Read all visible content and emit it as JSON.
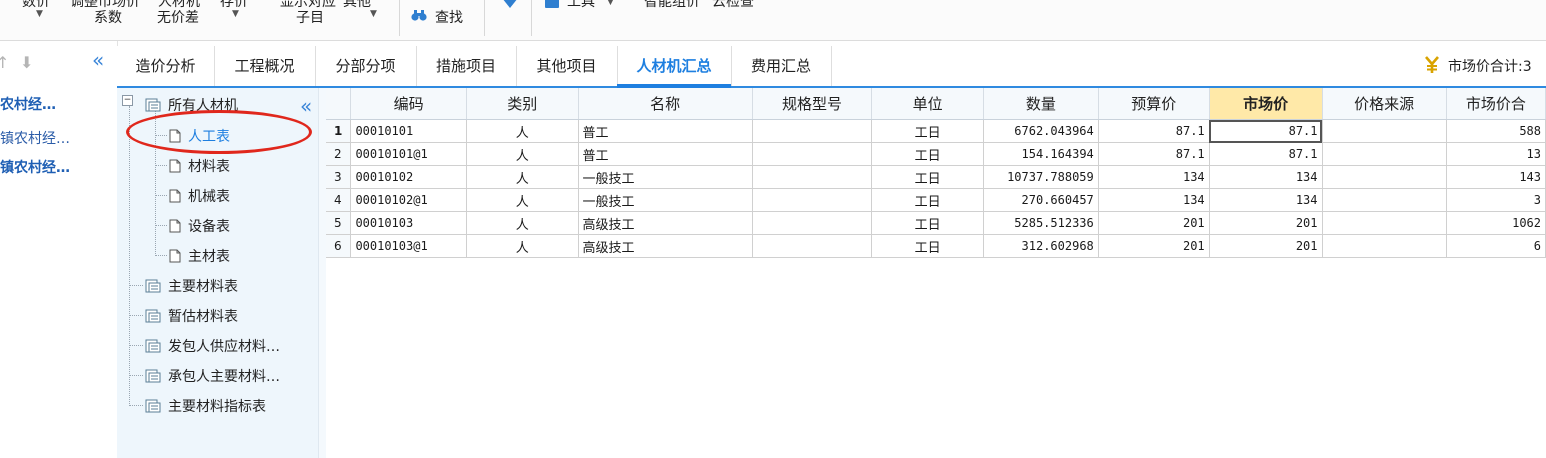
{
  "ribbon": {
    "row1_partial": [
      "数价",
      "调整市场价",
      "人材机",
      "存价",
      "显示对应",
      "其他",
      "智能组价",
      "云检查"
    ],
    "row2": [
      "系数",
      "无价差",
      "子目"
    ],
    "find_label": "查找",
    "tool_label": "工具"
  },
  "left_nav": {
    "projects": [
      "农村经…",
      "镇农村经…",
      "镇农村经…"
    ]
  },
  "tabs": [
    {
      "label": "造价分析"
    },
    {
      "label": "工程概况"
    },
    {
      "label": "分部分项"
    },
    {
      "label": "措施项目"
    },
    {
      "label": "其他项目"
    },
    {
      "label": "人材机汇总",
      "active": true
    },
    {
      "label": "费用汇总"
    }
  ],
  "market_total_label": "市场价合计:3",
  "tree": {
    "root": "所有人材机",
    "children": [
      "人工表",
      "材料表",
      "机械表",
      "设备表",
      "主材表"
    ],
    "reports": [
      "主要材料表",
      "暂估材料表",
      "发包人供应材料…",
      "承包人主要材料…",
      "主要材料指标表"
    ],
    "selected": "人工表"
  },
  "grid": {
    "columns": [
      "编码",
      "类别",
      "名称",
      "规格型号",
      "单位",
      "数量",
      "预算价",
      "市场价",
      "价格来源",
      "市场价合"
    ],
    "rows": [
      {
        "no": "1",
        "code": "00010101",
        "type": "人",
        "name": "普工",
        "spec": "",
        "unit": "工日",
        "qty": "6762.043964",
        "budget": "87.1",
        "market": "87.1",
        "source": "",
        "market_total": "588"
      },
      {
        "no": "2",
        "code": "00010101@1",
        "type": "人",
        "name": "普工",
        "spec": "",
        "unit": "工日",
        "qty": "154.164394",
        "budget": "87.1",
        "market": "87.1",
        "source": "",
        "market_total": "13"
      },
      {
        "no": "3",
        "code": "00010102",
        "type": "人",
        "name": "一般技工",
        "spec": "",
        "unit": "工日",
        "qty": "10737.788059",
        "budget": "134",
        "market": "134",
        "source": "",
        "market_total": "143"
      },
      {
        "no": "4",
        "code": "00010102@1",
        "type": "人",
        "name": "一般技工",
        "spec": "",
        "unit": "工日",
        "qty": "270.660457",
        "budget": "134",
        "market": "134",
        "source": "",
        "market_total": "3"
      },
      {
        "no": "5",
        "code": "00010103",
        "type": "人",
        "name": "高级技工",
        "spec": "",
        "unit": "工日",
        "qty": "5285.512336",
        "budget": "201",
        "market": "201",
        "source": "",
        "market_total": "1062"
      },
      {
        "no": "6",
        "code": "00010103@1",
        "type": "人",
        "name": "高级技工",
        "spec": "",
        "unit": "工日",
        "qty": "312.602968",
        "budget": "201",
        "market": "201",
        "source": "",
        "market_total": "6"
      }
    ]
  },
  "colors": {
    "accent": "#1e7fe0",
    "highlight_header": "#ffe9a8",
    "annotation": "#e0271c",
    "tree_bg": "#eef6fc"
  },
  "icons": [
    "binoculars-icon",
    "down-arrow-icon",
    "tools-icon",
    "yen-coin-icon",
    "doc-icon",
    "report-icon",
    "collapse-icon",
    "up-arrow-icon",
    "down-move-icon"
  ]
}
